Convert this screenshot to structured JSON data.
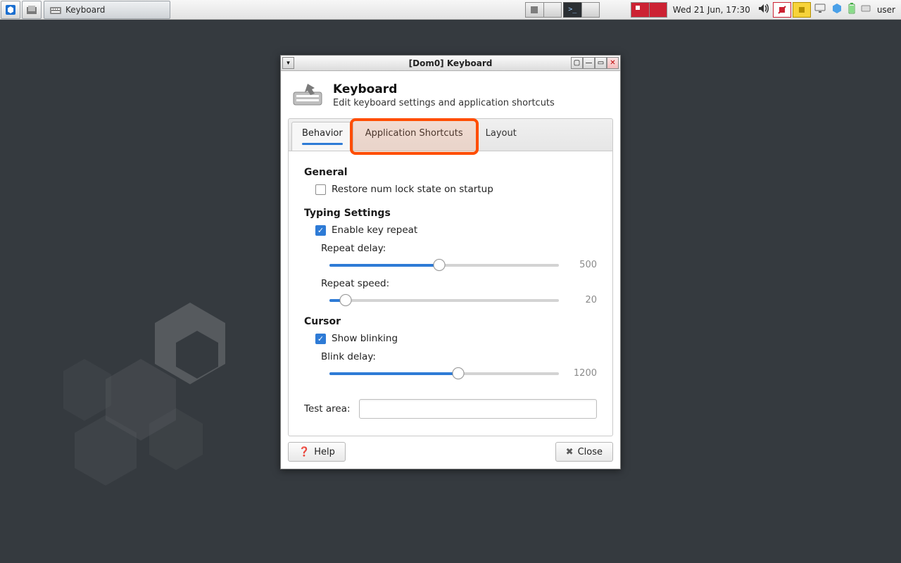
{
  "taskbar": {
    "active_task": "Keyboard",
    "clock": "Wed 21 Jun, 17:30",
    "user": "user"
  },
  "window": {
    "title": "[Dom0] Keyboard",
    "header_title": "Keyboard",
    "header_sub": "Edit keyboard settings and application shortcuts",
    "tabs": [
      "Behavior",
      "Application Shortcuts",
      "Layout"
    ],
    "active_tab": 0,
    "highlight_tab": 1
  },
  "behavior": {
    "section_general": "General",
    "restore_numlock_label": "Restore num lock state on startup",
    "restore_numlock_checked": false,
    "section_typing": "Typing Settings",
    "enable_repeat_label": "Enable key repeat",
    "enable_repeat_checked": true,
    "repeat_delay_label": "Repeat delay:",
    "repeat_delay_value": "500",
    "repeat_delay_fill_pct": 48,
    "repeat_speed_label": "Repeat speed:",
    "repeat_speed_value": "20",
    "repeat_speed_fill_pct": 7,
    "section_cursor": "Cursor",
    "show_blinking_label": "Show blinking",
    "show_blinking_checked": true,
    "blink_delay_label": "Blink delay:",
    "blink_delay_value": "1200",
    "blink_delay_fill_pct": 56,
    "test_area_label": "Test area:"
  },
  "footer": {
    "help": "Help",
    "close": "Close"
  }
}
